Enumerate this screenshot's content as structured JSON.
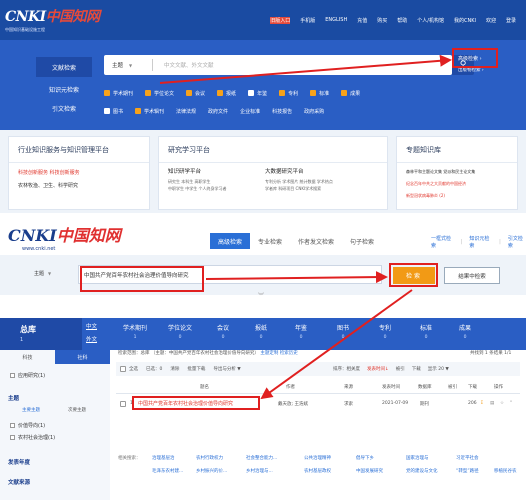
{
  "top": {
    "logo": {
      "cn": "CNKI",
      "cn_suffix": "中国知网",
      "sub": "中国知识基础设施工程"
    },
    "nav": [
      "旧版入口",
      "手机版",
      "ENGLISH",
      "充值",
      "购买",
      "帮助",
      "个人/机构馆",
      "我的CNKI",
      "欢迎",
      "登录"
    ],
    "left_tabs": [
      "文献检索",
      "知识元检索",
      "引文检索"
    ],
    "search": {
      "field": "主题",
      "field_arrow": "▼",
      "placeholder": "中文文献、外文文献",
      "icon": "search-icon",
      "adv": "高级检索 ›",
      "pub": "出版物检索 ›"
    },
    "checkboxes_row1": [
      {
        "label": "学术期刊",
        "checked": true
      },
      {
        "label": "学位论文",
        "checked": true
      },
      {
        "label": "会议",
        "checked": true
      },
      {
        "label": "报纸",
        "checked": true
      },
      {
        "label": "年鉴",
        "checked": false
      },
      {
        "label": "专利",
        "checked": true
      },
      {
        "label": "标准",
        "checked": true
      },
      {
        "label": "成果",
        "checked": true
      }
    ],
    "checkboxes_row2": [
      {
        "label": "图书",
        "checked": false
      },
      {
        "label": "学术辑刊",
        "checked": true
      },
      {
        "label": "法律法规",
        "checked": false
      },
      {
        "label": "政府文件",
        "checked": false
      },
      {
        "label": "企业标准",
        "checked": false
      },
      {
        "label": "科技报告",
        "checked": false
      },
      {
        "label": "政府采购",
        "checked": false
      }
    ],
    "card1": {
      "title": "行业知识服务与知识管理平台",
      "l1": "科技创新服务    科技创新服务",
      "l2": "农林牧渔、卫生、科学研究"
    },
    "card2": {
      "title": "研究学习平台",
      "col1_title": "知识研学平台",
      "col1_lines": [
        "研究生   本科生   高职学生",
        "中职学生   中学生   个人终身学习者"
      ],
      "col2_title": "大数据研究平台",
      "col2_lines": [
        "专利分析   学术图片   统计数据   学术热点",
        "学者库   科研项目   CNKI学术搜索"
      ]
    },
    "card3": {
      "title": "专题知识库",
      "lines": [
        "森林平和主题论文集   党派和民主论文集",
        "纪念百年中共之大贡献的中国经济",
        "新型冠状病毒肺炎 (2)"
      ]
    }
  },
  "bottom": {
    "logo": {
      "cn": "CNKI",
      "cn_suffix": "中国知网",
      "url": "www.cnki.net"
    },
    "tabs": [
      "高级检索",
      "专业检索",
      "作者发文检索",
      "句子检索"
    ],
    "right_links": [
      "一框式检索",
      "知识元检索",
      "引文检索"
    ],
    "field": "主题",
    "field_arrow": "▼",
    "query": "中国共产党百年农村社会治理价值导向研究",
    "search_btn": "检索",
    "within_btn": "结果中检索",
    "chevron": "︾",
    "zk": {
      "label": "总库",
      "count": "1",
      "lang1": "中文",
      "lang2": "外文"
    },
    "db_tabs": [
      {
        "name": "学术期刊",
        "count": "1"
      },
      {
        "name": "学位论文",
        "count": "0"
      },
      {
        "name": "会议",
        "count": "0"
      },
      {
        "name": "报纸",
        "count": "0"
      },
      {
        "name": "年鉴",
        "count": "0"
      },
      {
        "name": "图书",
        "count": "0"
      },
      {
        "name": "专利",
        "count": "0"
      },
      {
        "name": "标准",
        "count": "0"
      },
      {
        "name": "成果",
        "count": "0"
      }
    ],
    "side_tabs": [
      "科技",
      "社科"
    ],
    "side": {
      "check1": "应用研究(1)",
      "h_topic": "主题",
      "topic_tabs": [
        "主要主题",
        "次要主题"
      ],
      "topic_items": [
        "价值导向(1)",
        "农村社会治理(1)"
      ],
      "h_year": "发表年度",
      "h_src": "文献来源"
    },
    "crumb_prefix": "检索范围：",
    "crumb_text": "总库  （主题：中国共产党百年农村社会治理价值导向研究）",
    "crumb_link": "主题定制",
    "crumb_hist": "检索历史",
    "count_text": "共找到 1 条结果",
    "pager": "1/1",
    "tools_left": [
      "全选",
      "已选：0",
      "清除",
      "批量下载",
      "导出与分析 ▼"
    ],
    "tools_right": [
      "排序：相关度",
      "发表时间↓",
      "被引",
      "下载",
      "显示 20 ▼"
    ],
    "head": [
      "题名",
      "作者",
      "来源",
      "发表时间",
      "数据库",
      "被引",
      "下载",
      "操作"
    ],
    "row": {
      "num": "1",
      "title": "中国共产党百年农村社会治理价值导向研究",
      "author": "戴天放; 王浩斌",
      "source": "求索",
      "date": "2021-07-09",
      "db": "期刊",
      "cite": "",
      "dl": "206"
    },
    "related_label": "相关搜索：",
    "related_row1": [
      "治理基层治",
      "农村行政权力",
      "社会整合能力...",
      "公共治理精神",
      "倡导下乡",
      "国家治理与",
      "习近平社会"
    ],
    "related_row2": [
      "毛泽东农村建...",
      "乡村振兴的价...",
      "乡村治理与...",
      "农村基层政权",
      "中国发展研究",
      "党的建设与文化",
      "“转型”路径",
      "移植民谷农"
    ]
  },
  "colors": {
    "blue": "#2a5ec4",
    "dark_blue": "#1a4ba2",
    "orange": "#f29a15",
    "red": "#e02020"
  }
}
